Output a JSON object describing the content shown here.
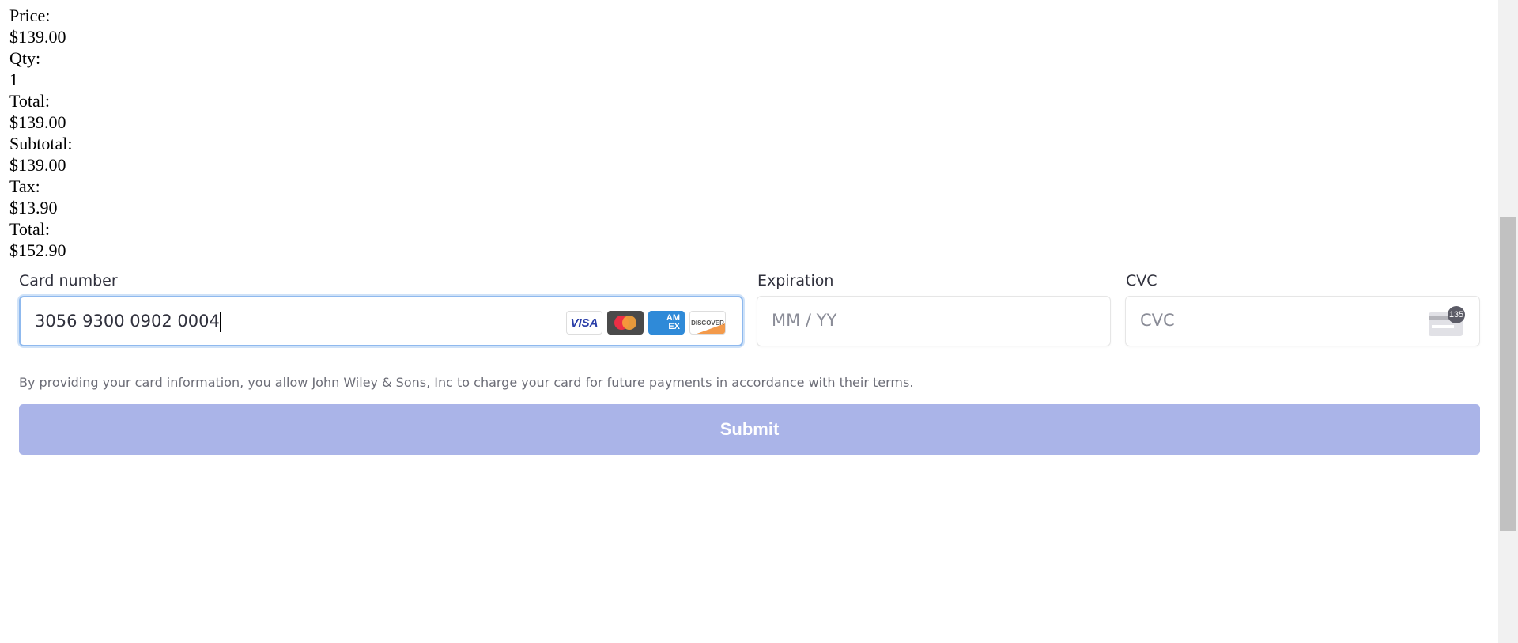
{
  "summary": [
    {
      "label": "Price:",
      "value": "$139.00"
    },
    {
      "label": "Qty:",
      "value": "1"
    },
    {
      "label": "Total:",
      "value": "$139.00"
    },
    {
      "label": "Subtotal:",
      "value": "$139.00"
    },
    {
      "label": "Tax:",
      "value": "$13.90"
    },
    {
      "label": "Total:",
      "value": "$152.90"
    }
  ],
  "payment": {
    "card_label": "Card number",
    "card_value": "3056 9300 0902 0004",
    "brands": [
      "VISA",
      "Mastercard",
      "AMEX",
      "DISCOVER"
    ],
    "exp_label": "Expiration",
    "exp_placeholder": "MM / YY",
    "cvc_label": "CVC",
    "cvc_placeholder": "CVC",
    "cvc_badge": "135",
    "terms": "By providing your card information, you allow John Wiley & Sons, Inc to charge your card for future payments in accordance with their terms.",
    "submit": "Submit"
  },
  "colors": {
    "submit": "#aab4e8",
    "focus": "#8fb9ee"
  }
}
